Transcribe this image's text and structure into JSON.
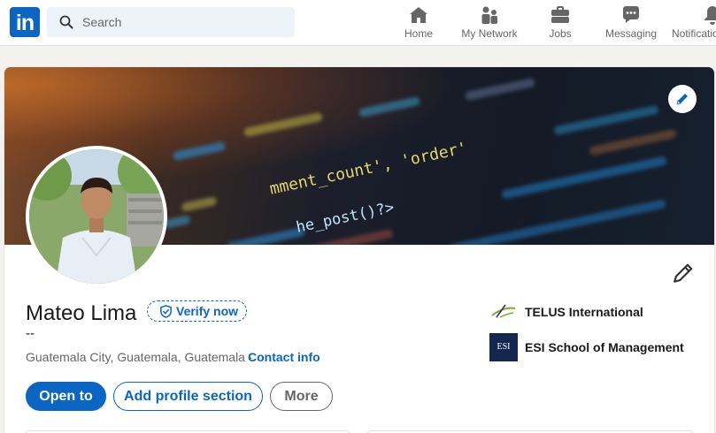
{
  "nav": {
    "logo_text": "in",
    "search_placeholder": "Search",
    "items": [
      {
        "label": "Home",
        "icon": "home-icon"
      },
      {
        "label": "My Network",
        "icon": "network-icon"
      },
      {
        "label": "Jobs",
        "icon": "briefcase-icon"
      },
      {
        "label": "Messaging",
        "icon": "messaging-icon"
      },
      {
        "label": "Notifications",
        "icon": "bell-icon"
      }
    ]
  },
  "banner": {
    "code_text": {
      "line1": "mment_count', 'order'",
      "line2": "he_post()?>"
    }
  },
  "profile": {
    "name": "Mateo Lima",
    "verify_label": "Verify now",
    "headline": "--",
    "location": "Guatemala City, Guatemala, Guatemala ·",
    "contact_label": "Contact info",
    "buttons": {
      "open_to": "Open to",
      "add_section": "Add profile section",
      "more": "More"
    },
    "organizations": [
      {
        "name": "TELUS International",
        "icon": "telus-logo"
      },
      {
        "name": "ESI School of Management",
        "icon": "esi-logo",
        "logo_text": "ESI"
      }
    ]
  },
  "colors": {
    "brand": "#0a66c2",
    "page_bg": "#f4f2ee",
    "search_bg": "#edf3f8"
  }
}
